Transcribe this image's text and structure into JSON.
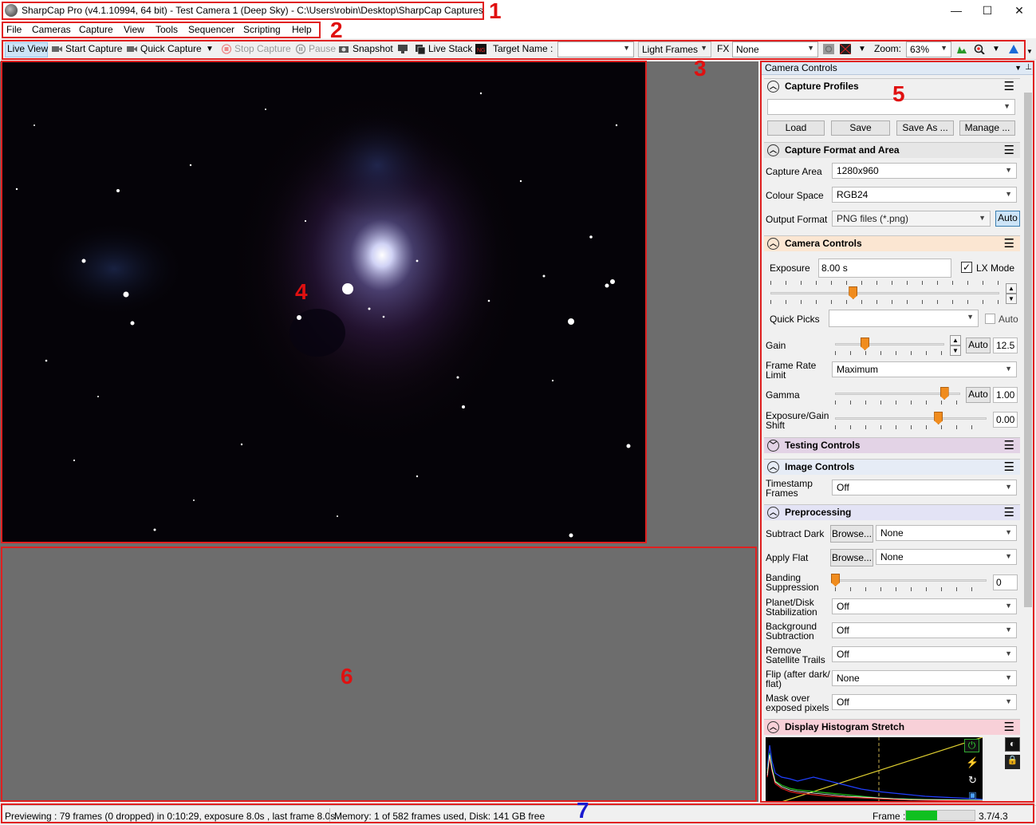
{
  "window": {
    "title": "SharpCap Pro (v4.1.10994, 64 bit) - Test Camera 1 (Deep Sky) - C:\\Users\\robin\\Desktop\\SharpCap Captures",
    "minimize": "—",
    "maximize": "☐",
    "close": "✕"
  },
  "menu": {
    "items": [
      "File",
      "Cameras",
      "Capture",
      "View",
      "Tools",
      "Sequencer",
      "Scripting",
      "Help"
    ]
  },
  "toolbar": {
    "live_view": "Live View",
    "start_capture": "Start Capture",
    "quick_capture": "Quick Capture",
    "stop_capture": "Stop Capture",
    "pause": "Pause",
    "snapshot": "Snapshot",
    "live_stack": "Live Stack",
    "target_name_label": "Target Name :",
    "target_name_value": "",
    "frame_type": "Light Frames",
    "fx_label": "FX",
    "fx_value": "None",
    "zoom_label": "Zoom:",
    "zoom_value": "63%"
  },
  "callouts": [
    "1",
    "2",
    "3",
    "4",
    "5",
    "6",
    "7"
  ],
  "panel": {
    "header": "Camera Controls",
    "capture_profiles": {
      "title": "Capture Profiles",
      "profile_value": "",
      "load": "Load",
      "save": "Save",
      "save_as": "Save As ...",
      "manage": "Manage ..."
    },
    "capture_format": {
      "title": "Capture Format and Area",
      "capture_area_label": "Capture Area",
      "capture_area_value": "1280x960",
      "colour_space_label": "Colour Space",
      "colour_space_value": "RGB24",
      "output_format_label": "Output Format",
      "output_format_value": "PNG files (*.png)",
      "auto": "Auto"
    },
    "camera_controls": {
      "title": "Camera Controls",
      "exposure_label": "Exposure",
      "exposure_value": "8.00 s",
      "lx_mode_label": "LX Mode",
      "lx_mode_checked": true,
      "quick_picks_label": "Quick Picks",
      "quick_picks_value": "",
      "quick_picks_auto": "Auto",
      "gain_label": "Gain",
      "gain_auto": "Auto",
      "gain_value": "12.5",
      "frame_rate_label": "Frame Rate Limit",
      "frame_rate_value": "Maximum",
      "gamma_label": "Gamma",
      "gamma_auto": "Auto",
      "gamma_value": "1.00",
      "exposure_gain_shift_label": "Exposure/Gain Shift",
      "exposure_gain_shift_value": "0.00"
    },
    "testing_controls": {
      "title": "Testing Controls"
    },
    "image_controls": {
      "title": "Image Controls",
      "timestamp_label": "Timestamp Frames",
      "timestamp_value": "Off"
    },
    "preprocessing": {
      "title": "Preprocessing",
      "subtract_dark_label": "Subtract Dark",
      "subtract_dark_browse": "Browse...",
      "subtract_dark_value": "None",
      "apply_flat_label": "Apply Flat",
      "apply_flat_browse": "Browse...",
      "apply_flat_value": "None",
      "banding_label": "Banding Suppression",
      "banding_value": "0",
      "planet_label": "Planet/Disk Stabilization",
      "planet_value": "Off",
      "background_label": "Background Subtraction",
      "background_value": "Off",
      "satellite_label": "Remove Satellite Trails",
      "satellite_value": "Off",
      "flip_label": "Flip (after dark/ flat)",
      "flip_value": "None",
      "mask_label": "Mask over exposed pixels",
      "mask_value": "Off"
    },
    "histogram": {
      "title": "Display Histogram Stretch"
    }
  },
  "status": {
    "previewing": "Previewing : 79 frames (0 dropped) in 0:10:29, exposure 8.0s , last frame 8.0s",
    "memory": "Memory: 1 of 582 frames used, Disk: 141 GB free",
    "frame_label": "Frame :",
    "frame_value": "3.7/4.3"
  },
  "colors": {
    "accent_red": "#e02020",
    "callout_blue": "#1a1ad0",
    "slider_orange": "#f08c1e",
    "camera_header": "#fbe6d2",
    "testing_header": "#e3d3e6",
    "image_header": "#e6ecf6",
    "preproc_header": "#e3e3f5",
    "histo_header": "#f8d0d8",
    "frame_bar": "#10c020"
  },
  "sliders": {
    "exposure_fraction": 0.36,
    "gain_fraction": 0.27,
    "gamma_fraction": 0.87,
    "shift_fraction": 0.68,
    "banding_fraction": 0.0,
    "frame_fraction": 0.45
  }
}
